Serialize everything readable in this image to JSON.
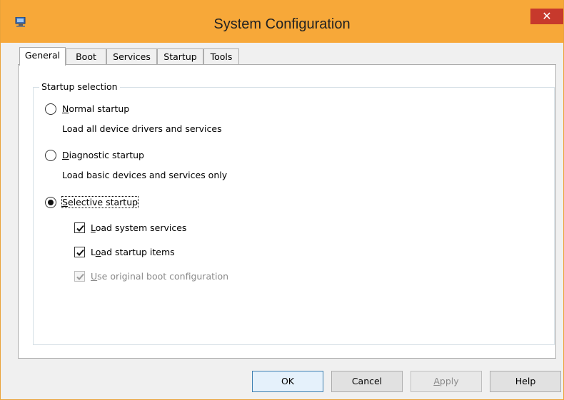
{
  "window": {
    "title": "System Configuration",
    "close_label": "✕"
  },
  "tabs": [
    {
      "label": "General",
      "selected": true
    },
    {
      "label": "Boot",
      "selected": false
    },
    {
      "label": "Services",
      "selected": false
    },
    {
      "label": "Startup",
      "selected": false
    },
    {
      "label": "Tools",
      "selected": false
    }
  ],
  "startup_selection": {
    "group_label": "Startup selection",
    "options": [
      {
        "label": "Normal startup",
        "mnemonic": "N",
        "rest": "ormal startup",
        "description": "Load all device drivers and services",
        "checked": false
      },
      {
        "label": "Diagnostic startup",
        "mnemonic": "D",
        "rest": "iagnostic startup",
        "description": "Load basic devices and services only",
        "checked": false
      },
      {
        "label": "Selective startup",
        "mnemonic": "S",
        "rest": "elective startup",
        "description": "",
        "checked": true
      }
    ],
    "selective_items": [
      {
        "label": "Load system services",
        "mnemonic": "L",
        "rest": "oad system services",
        "checked": true,
        "enabled": true
      },
      {
        "label": "Load startup items",
        "mnemonic": "o",
        "pre": "L",
        "rest": "ad startup items",
        "checked": true,
        "enabled": true
      },
      {
        "label": "Use original boot configuration",
        "mnemonic": "U",
        "rest": "se original boot configuration",
        "checked": true,
        "enabled": false
      }
    ]
  },
  "buttons": {
    "ok": "OK",
    "cancel": "Cancel",
    "apply_mnemonic": "A",
    "apply_rest": "pply",
    "help": "Help"
  },
  "colors": {
    "titlebar": "#f7a839",
    "close": "#c7392c",
    "default_button_border": "#3c7fb1"
  }
}
